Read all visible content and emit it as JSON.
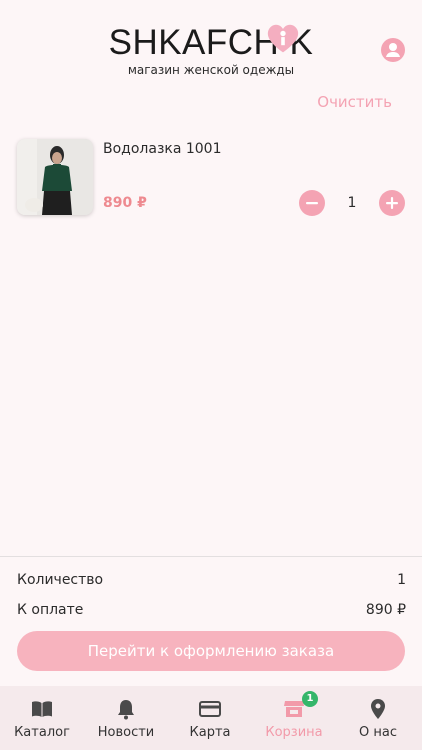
{
  "header": {
    "logo_text": "SHKAFCH K",
    "logo_heart_letter": "i",
    "subtitle": "магазин женской одежды",
    "profile_icon": "user-icon"
  },
  "cart": {
    "clear_label": "Очистить",
    "items": [
      {
        "name": "Водолазка 1001",
        "price": "890 ₽",
        "quantity": "1"
      }
    ]
  },
  "summary": {
    "quantity_label": "Количество",
    "quantity_value": "1",
    "total_label": "К оплате",
    "total_value": "890 ₽",
    "checkout_label": "Перейти к оформлению заказа"
  },
  "tabbar": {
    "tabs": [
      {
        "label": "Каталог",
        "icon": "book-icon"
      },
      {
        "label": "Новости",
        "icon": "bell-icon"
      },
      {
        "label": "Карта",
        "icon": "card-icon"
      },
      {
        "label": "Корзина",
        "icon": "store-icon",
        "badge": "1",
        "active": true
      },
      {
        "label": "О нас",
        "icon": "location-pin-icon"
      }
    ]
  },
  "colors": {
    "accent": "#f4a3b3",
    "price": "#ee8a90",
    "badge": "#35b66a",
    "background": "#fdf6f7"
  }
}
